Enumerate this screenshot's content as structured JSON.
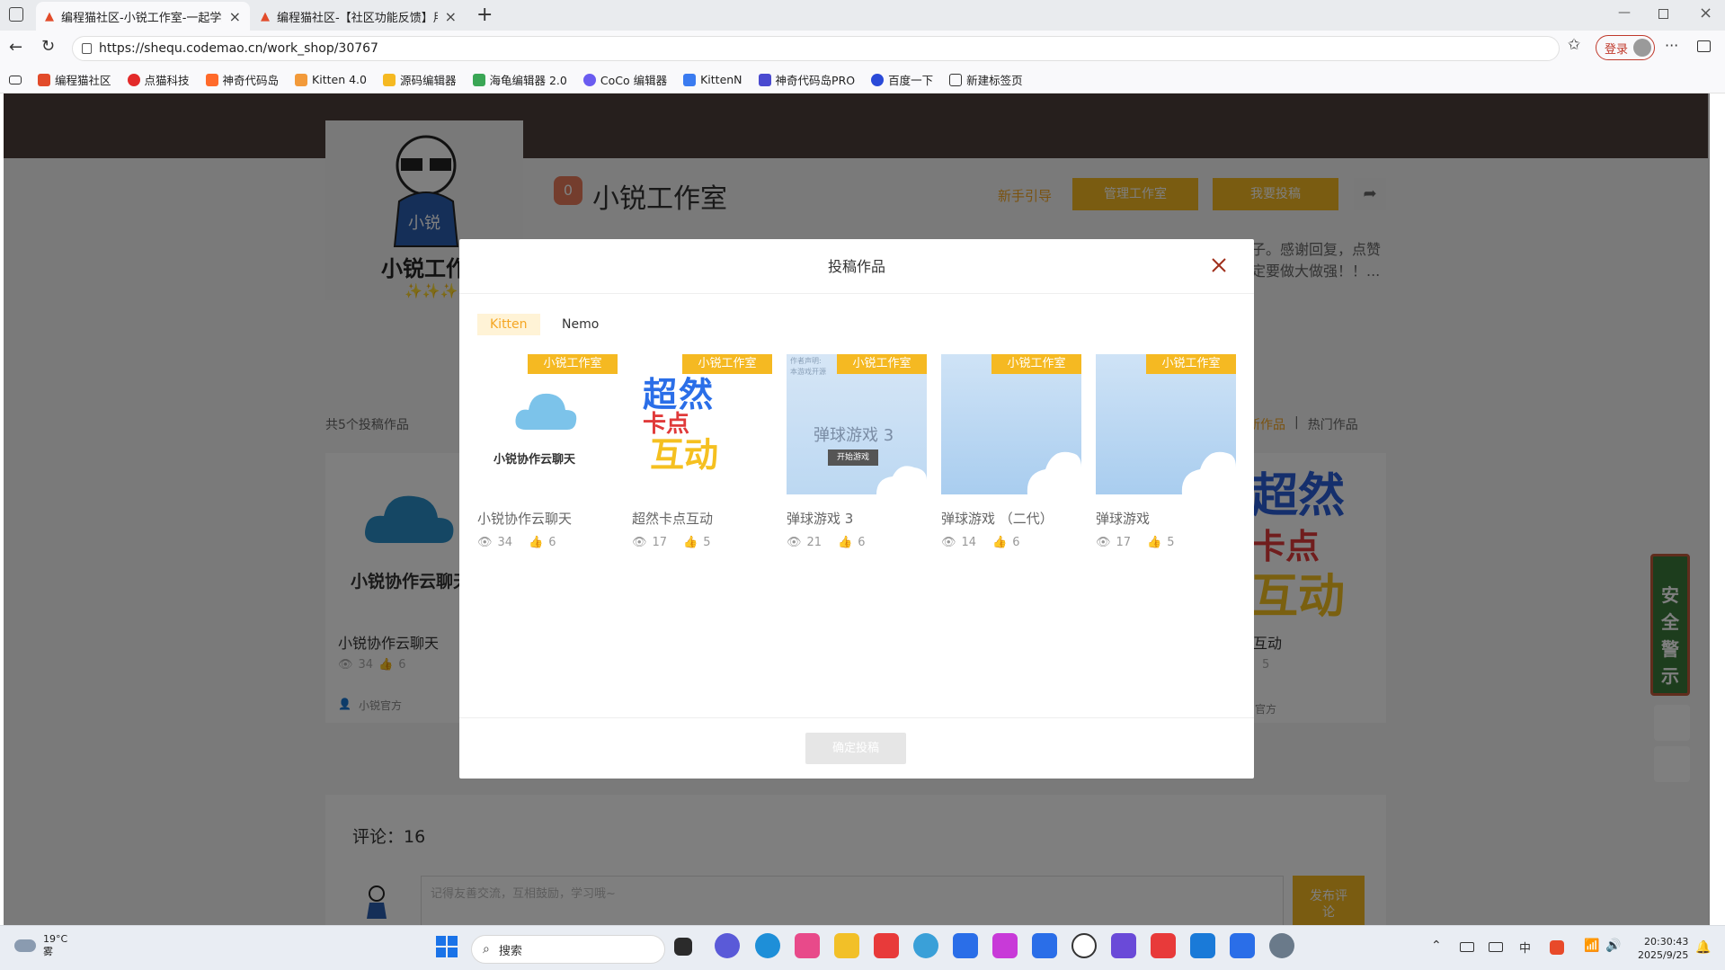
{
  "browser": {
    "tabs": [
      {
        "title": "编程猫社区-小锐工作室-一起学编程",
        "active": true
      },
      {
        "title": "编程猫社区-【社区功能反馈】用户",
        "active": false
      }
    ],
    "url": "https://shequ.codemao.cn/work_shop/30767",
    "login_label": "登录",
    "bookmarks": [
      "编程猫社区",
      "点猫科技",
      "神奇代码岛",
      "Kitten 4.0",
      "源码编辑器",
      "海龟编辑器 2.0",
      "CoCo 编辑器",
      "KittenN",
      "神奇代码岛PRO",
      "百度一下",
      "新建标签页"
    ]
  },
  "page": {
    "studio_name": "小锐工作室",
    "studio_level": "0",
    "guide_link": "新手引导",
    "manage_button": "管理工作室",
    "submit_button": "我要投稿",
    "description_line1": "子。感谢回复，点赞",
    "description_line2": "定要做大做强！！...",
    "works_count": "共5个投稿作品",
    "sort_latest": "最新作品",
    "sort_hot": "热门作品",
    "bg_card1_title": "小锐协作云聊天",
    "bg_card1_views": "34",
    "bg_card1_likes": "6",
    "bg_card1_author": "小锐官方",
    "bg_card2_title": "互动",
    "bg_card2_likes": "5",
    "bg_card2_author": "官方",
    "comments_label": "评论：16",
    "comment_placeholder": "记得友善交流，互相鼓励，学习哦~",
    "publish_button": "发布评论",
    "safety_label": [
      "安",
      "全",
      "警",
      "示"
    ]
  },
  "modal": {
    "title": "投稿作品",
    "tabs": [
      "Kitten",
      "Nemo"
    ],
    "active_tab": "Kitten",
    "works": [
      {
        "title": "小锐协作云聊天",
        "views": "34",
        "likes": "6",
        "tag": "小锐工作室"
      },
      {
        "title": "超然卡点互动",
        "views": "17",
        "likes": "5",
        "tag": "小锐工作室"
      },
      {
        "title": "弹球游戏 3",
        "views": "21",
        "likes": "6",
        "tag": "小锐工作室"
      },
      {
        "title": "弹球游戏 （二代）",
        "views": "14",
        "likes": "6",
        "tag": "小锐工作室"
      },
      {
        "title": "弹球游戏",
        "views": "17",
        "likes": "5",
        "tag": "小锐工作室"
      }
    ],
    "thumb_texts": {
      "cloud_caption": "小锐协作云聊天",
      "chaoran_1": "超然",
      "chaoran_2": "卡点",
      "chaoran_3": "互动",
      "game_title": "弹球游戏 3",
      "game_start": "开始游戏",
      "game_note_1": "作者声明:",
      "game_note_2": "本游戏开源"
    },
    "confirm_button": "确定投稿"
  },
  "taskbar": {
    "weather_temp": "19°C",
    "weather_desc": "雾",
    "search_label": "搜索",
    "time": "20:30:43",
    "date": "2025/9/25"
  },
  "colors": {
    "accent": "#f5b922",
    "modal_tab_active_bg": "#fff3d6",
    "modal_tab_active_text": "#f5a623"
  }
}
